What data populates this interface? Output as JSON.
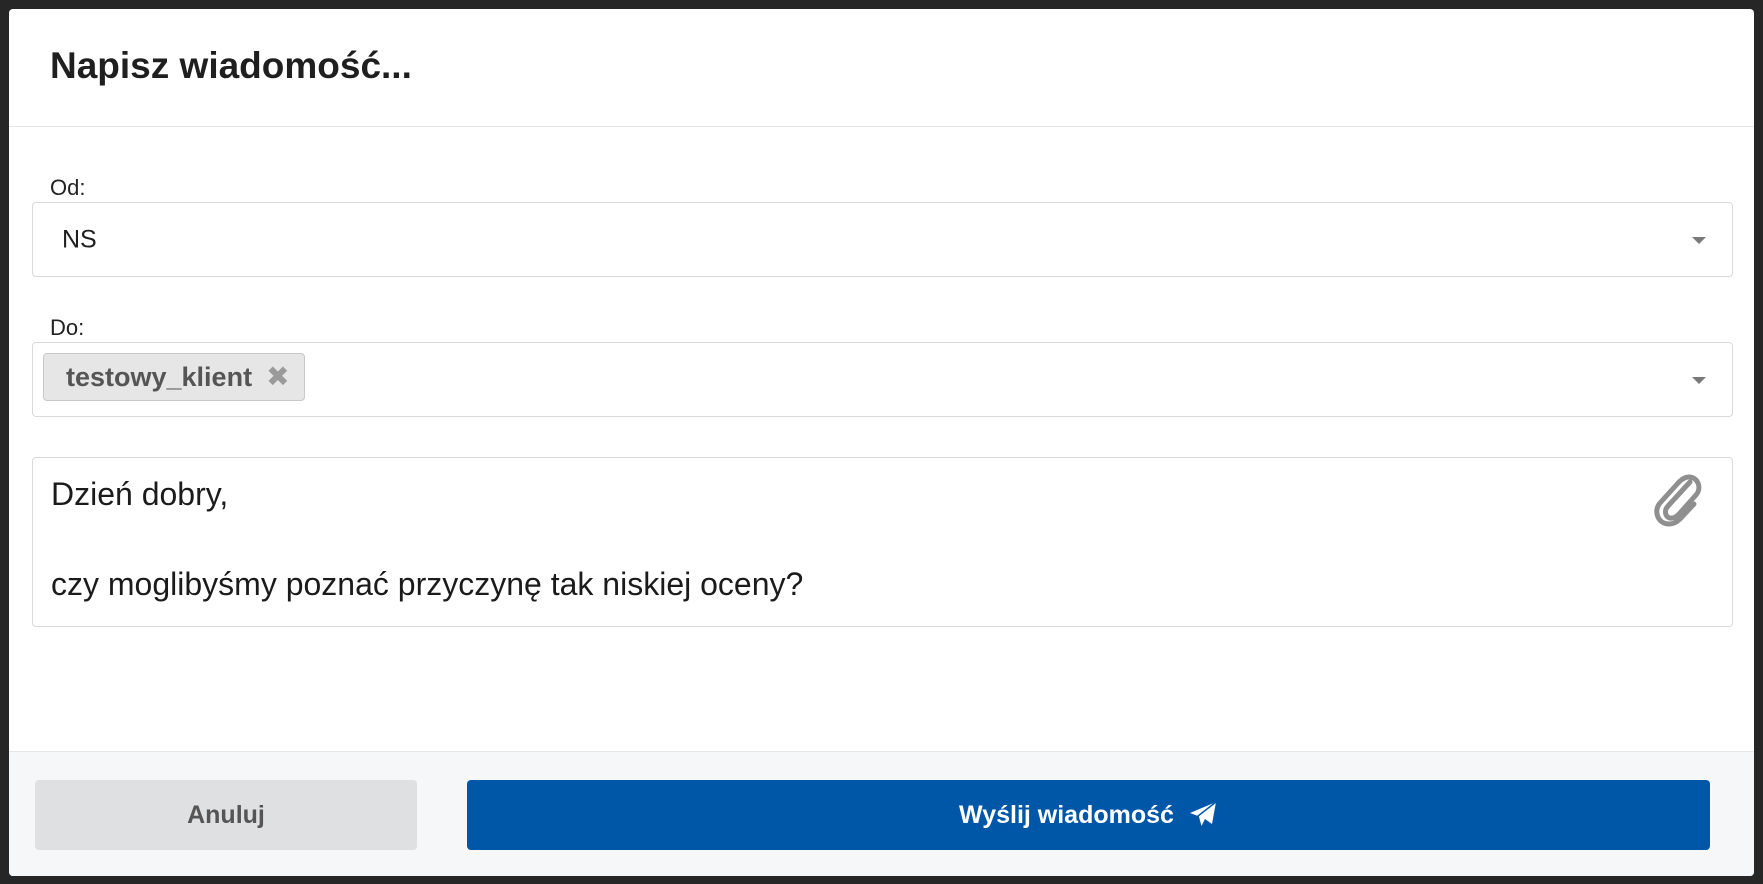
{
  "dialog": {
    "title": "Napisz wiadomość...",
    "from": {
      "label": "Od:",
      "value": "NS"
    },
    "to": {
      "label": "Do:",
      "recipients": [
        "testowy_klient"
      ]
    },
    "message": {
      "lines": [
        "Dzień dobry,",
        "",
        "czy moglibyśmy poznać przyczynę tak niskiej oceny?"
      ]
    },
    "buttons": {
      "cancel": "Anuluj",
      "send": "Wyślij wiadomość"
    }
  },
  "icons": {
    "attach": "paperclip-icon",
    "send": "paper-plane-icon",
    "remove": "close-icon",
    "dropdown": "chevron-down-icon"
  },
  "colors": {
    "primary": "#0056a7",
    "secondary_button": "#dfe0e2",
    "tag_background": "#e6e6e6"
  }
}
